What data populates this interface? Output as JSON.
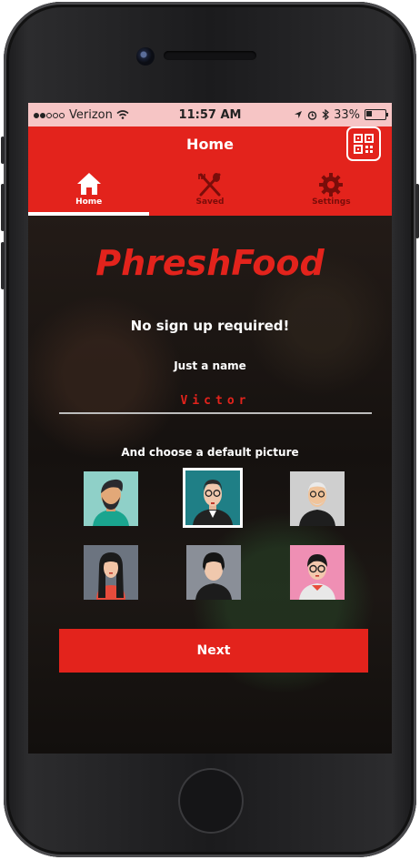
{
  "status_bar": {
    "carrier": "Verizon",
    "time": "11:57 AM",
    "battery": "33%"
  },
  "nav": {
    "title": "Home",
    "tabs": [
      {
        "label": "Home",
        "icon": "home-icon",
        "active": true
      },
      {
        "label": "Saved",
        "icon": "utensils-icon",
        "active": false
      },
      {
        "label": "Settings",
        "icon": "gear-icon",
        "active": false
      }
    ]
  },
  "main": {
    "brand": "PhreshFood",
    "tagline": "No sign up required!",
    "name_label": "Just a name",
    "name_value": "Victor",
    "choose_label": "And choose a default picture",
    "next_label": "Next"
  },
  "colors": {
    "accent": "#e3231c",
    "status_bar": "#f6c5c5"
  },
  "avatars": [
    {
      "name": "avatar-bearded-man",
      "selected": false
    },
    {
      "name": "avatar-man-glasses",
      "selected": true
    },
    {
      "name": "avatar-old-man",
      "selected": false
    },
    {
      "name": "avatar-woman-long-hair",
      "selected": false
    },
    {
      "name": "avatar-man-dark-hair",
      "selected": false
    },
    {
      "name": "avatar-woman-glasses",
      "selected": false
    }
  ]
}
